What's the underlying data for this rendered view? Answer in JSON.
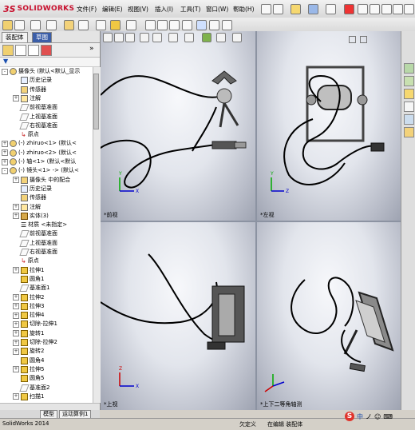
{
  "app": {
    "logo_ds": "3S",
    "logo_name": "SOLIDWORKS",
    "menus": [
      "文件(F)",
      "编辑(E)",
      "视图(V)",
      "插入(I)",
      "工具(T)",
      "窗口(W)",
      "帮助(H)"
    ]
  },
  "panel_tabs": [
    "装配体",
    "草图"
  ],
  "tree": [
    {
      "label": "摄像头  (默认<默认_显示",
      "level": 0,
      "icon": "gear",
      "exp": "-"
    },
    {
      "label": "历史记录",
      "level": 1,
      "icon": "doc",
      "exp": ""
    },
    {
      "label": "传感器",
      "level": 1,
      "icon": "sens",
      "exp": ""
    },
    {
      "label": "注解",
      "level": 1,
      "icon": "ann",
      "exp": "+"
    },
    {
      "label": "前视基准面",
      "level": 1,
      "icon": "plane",
      "exp": ""
    },
    {
      "label": "上视基准面",
      "level": 1,
      "icon": "plane",
      "exp": ""
    },
    {
      "label": "右视基准面",
      "level": 1,
      "icon": "plane",
      "exp": ""
    },
    {
      "label": "原点",
      "level": 1,
      "icon": "origin",
      "exp": ""
    },
    {
      "label": "(-) zhiruo<1> (默认<",
      "level": 0,
      "icon": "gear",
      "exp": "+"
    },
    {
      "label": "(-) zhiruo<2> (默认<",
      "level": 0,
      "icon": "gear",
      "exp": "+"
    },
    {
      "label": "(-) 轴<1> (默认<默认",
      "level": 0,
      "icon": "gear",
      "exp": "+"
    },
    {
      "label": "(-) 镜头<1> -> (默认<",
      "level": 0,
      "icon": "gear",
      "exp": "-"
    },
    {
      "label": "摄像头 中的配合",
      "level": 1,
      "icon": "sens",
      "exp": "+"
    },
    {
      "label": "历史记录",
      "level": 1,
      "icon": "doc",
      "exp": ""
    },
    {
      "label": "传感器",
      "level": 1,
      "icon": "sens",
      "exp": ""
    },
    {
      "label": "注解",
      "level": 1,
      "icon": "ann",
      "exp": "+"
    },
    {
      "label": "实体(3)",
      "level": 1,
      "icon": "cube",
      "exp": "+"
    },
    {
      "label": "材质 <未指定>",
      "level": 1,
      "icon": "mat",
      "exp": ""
    },
    {
      "label": "前视基准面",
      "level": 1,
      "icon": "plane",
      "exp": ""
    },
    {
      "label": "上视基准面",
      "level": 1,
      "icon": "plane",
      "exp": ""
    },
    {
      "label": "右视基准面",
      "level": 1,
      "icon": "plane",
      "exp": ""
    },
    {
      "label": "原点",
      "level": 1,
      "icon": "origin",
      "exp": ""
    },
    {
      "label": "拉伸1",
      "level": 1,
      "icon": "feat",
      "exp": "+"
    },
    {
      "label": "圆角1",
      "level": 1,
      "icon": "feat",
      "exp": ""
    },
    {
      "label": "基准面1",
      "level": 1,
      "icon": "plane",
      "exp": ""
    },
    {
      "label": "拉伸2",
      "level": 1,
      "icon": "feat",
      "exp": "+"
    },
    {
      "label": "拉伸3",
      "level": 1,
      "icon": "feat",
      "exp": "+"
    },
    {
      "label": "拉伸4",
      "level": 1,
      "icon": "feat",
      "exp": "+"
    },
    {
      "label": "切除-拉伸1",
      "level": 1,
      "icon": "feat",
      "exp": "+"
    },
    {
      "label": "旋转1",
      "level": 1,
      "icon": "feat",
      "exp": "+"
    },
    {
      "label": "切除-拉伸2",
      "level": 1,
      "icon": "feat",
      "exp": "+"
    },
    {
      "label": "旋转2",
      "level": 1,
      "icon": "feat",
      "exp": "+"
    },
    {
      "label": "圆角4",
      "level": 1,
      "icon": "feat",
      "exp": ""
    },
    {
      "label": "拉伸5",
      "level": 1,
      "icon": "feat",
      "exp": "+"
    },
    {
      "label": "圆角5",
      "level": 1,
      "icon": "feat",
      "exp": ""
    },
    {
      "label": "基准面2",
      "level": 1,
      "icon": "plane",
      "exp": ""
    },
    {
      "label": "扫描1",
      "level": 1,
      "icon": "feat",
      "exp": "+"
    }
  ],
  "views": {
    "front": "*前视",
    "left": "*左视",
    "top": "*上视",
    "iso": "*上下二等角轴测"
  },
  "bottom_tabs": [
    "模型",
    "运动算例1"
  ],
  "status": {
    "app": "SolidWorks 2014",
    "under": "欠定义",
    "editing": "在编辑 装配体"
  },
  "ime": {
    "logo": "S",
    "text": "中"
  }
}
